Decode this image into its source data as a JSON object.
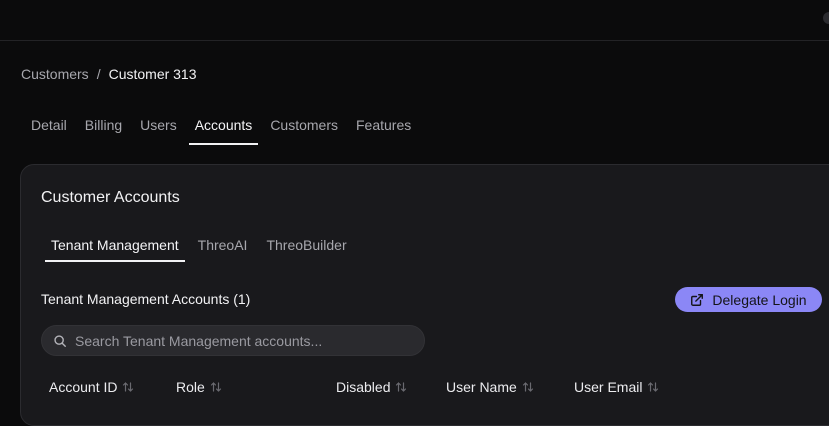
{
  "breadcrumb": {
    "parent": "Customers",
    "separator": "/",
    "current": "Customer 313"
  },
  "tabs": [
    {
      "label": "Detail",
      "active": false
    },
    {
      "label": "Billing",
      "active": false
    },
    {
      "label": "Users",
      "active": false
    },
    {
      "label": "Accounts",
      "active": true
    },
    {
      "label": "Customers",
      "active": false
    },
    {
      "label": "Features",
      "active": false
    }
  ],
  "card": {
    "title": "Customer Accounts",
    "subtabs": [
      {
        "label": "Tenant Management",
        "active": true
      },
      {
        "label": "ThreoAI",
        "active": false
      },
      {
        "label": "ThreoBuilder",
        "active": false
      }
    ],
    "section_title": "Tenant Management Accounts (1)",
    "delegate_button": {
      "label": "Delegate Login",
      "icon": "external-link-icon"
    },
    "search": {
      "placeholder": "Search Tenant Management accounts...",
      "value": ""
    },
    "columns": [
      {
        "label": "Account ID"
      },
      {
        "label": "Role"
      },
      {
        "label": "Disabled"
      },
      {
        "label": "User Name"
      },
      {
        "label": "User Email"
      }
    ]
  },
  "colors": {
    "background": "#0b0b0c",
    "card": "#19191c",
    "accent": "#8b87f6",
    "muted_text": "#a7a7ad"
  }
}
